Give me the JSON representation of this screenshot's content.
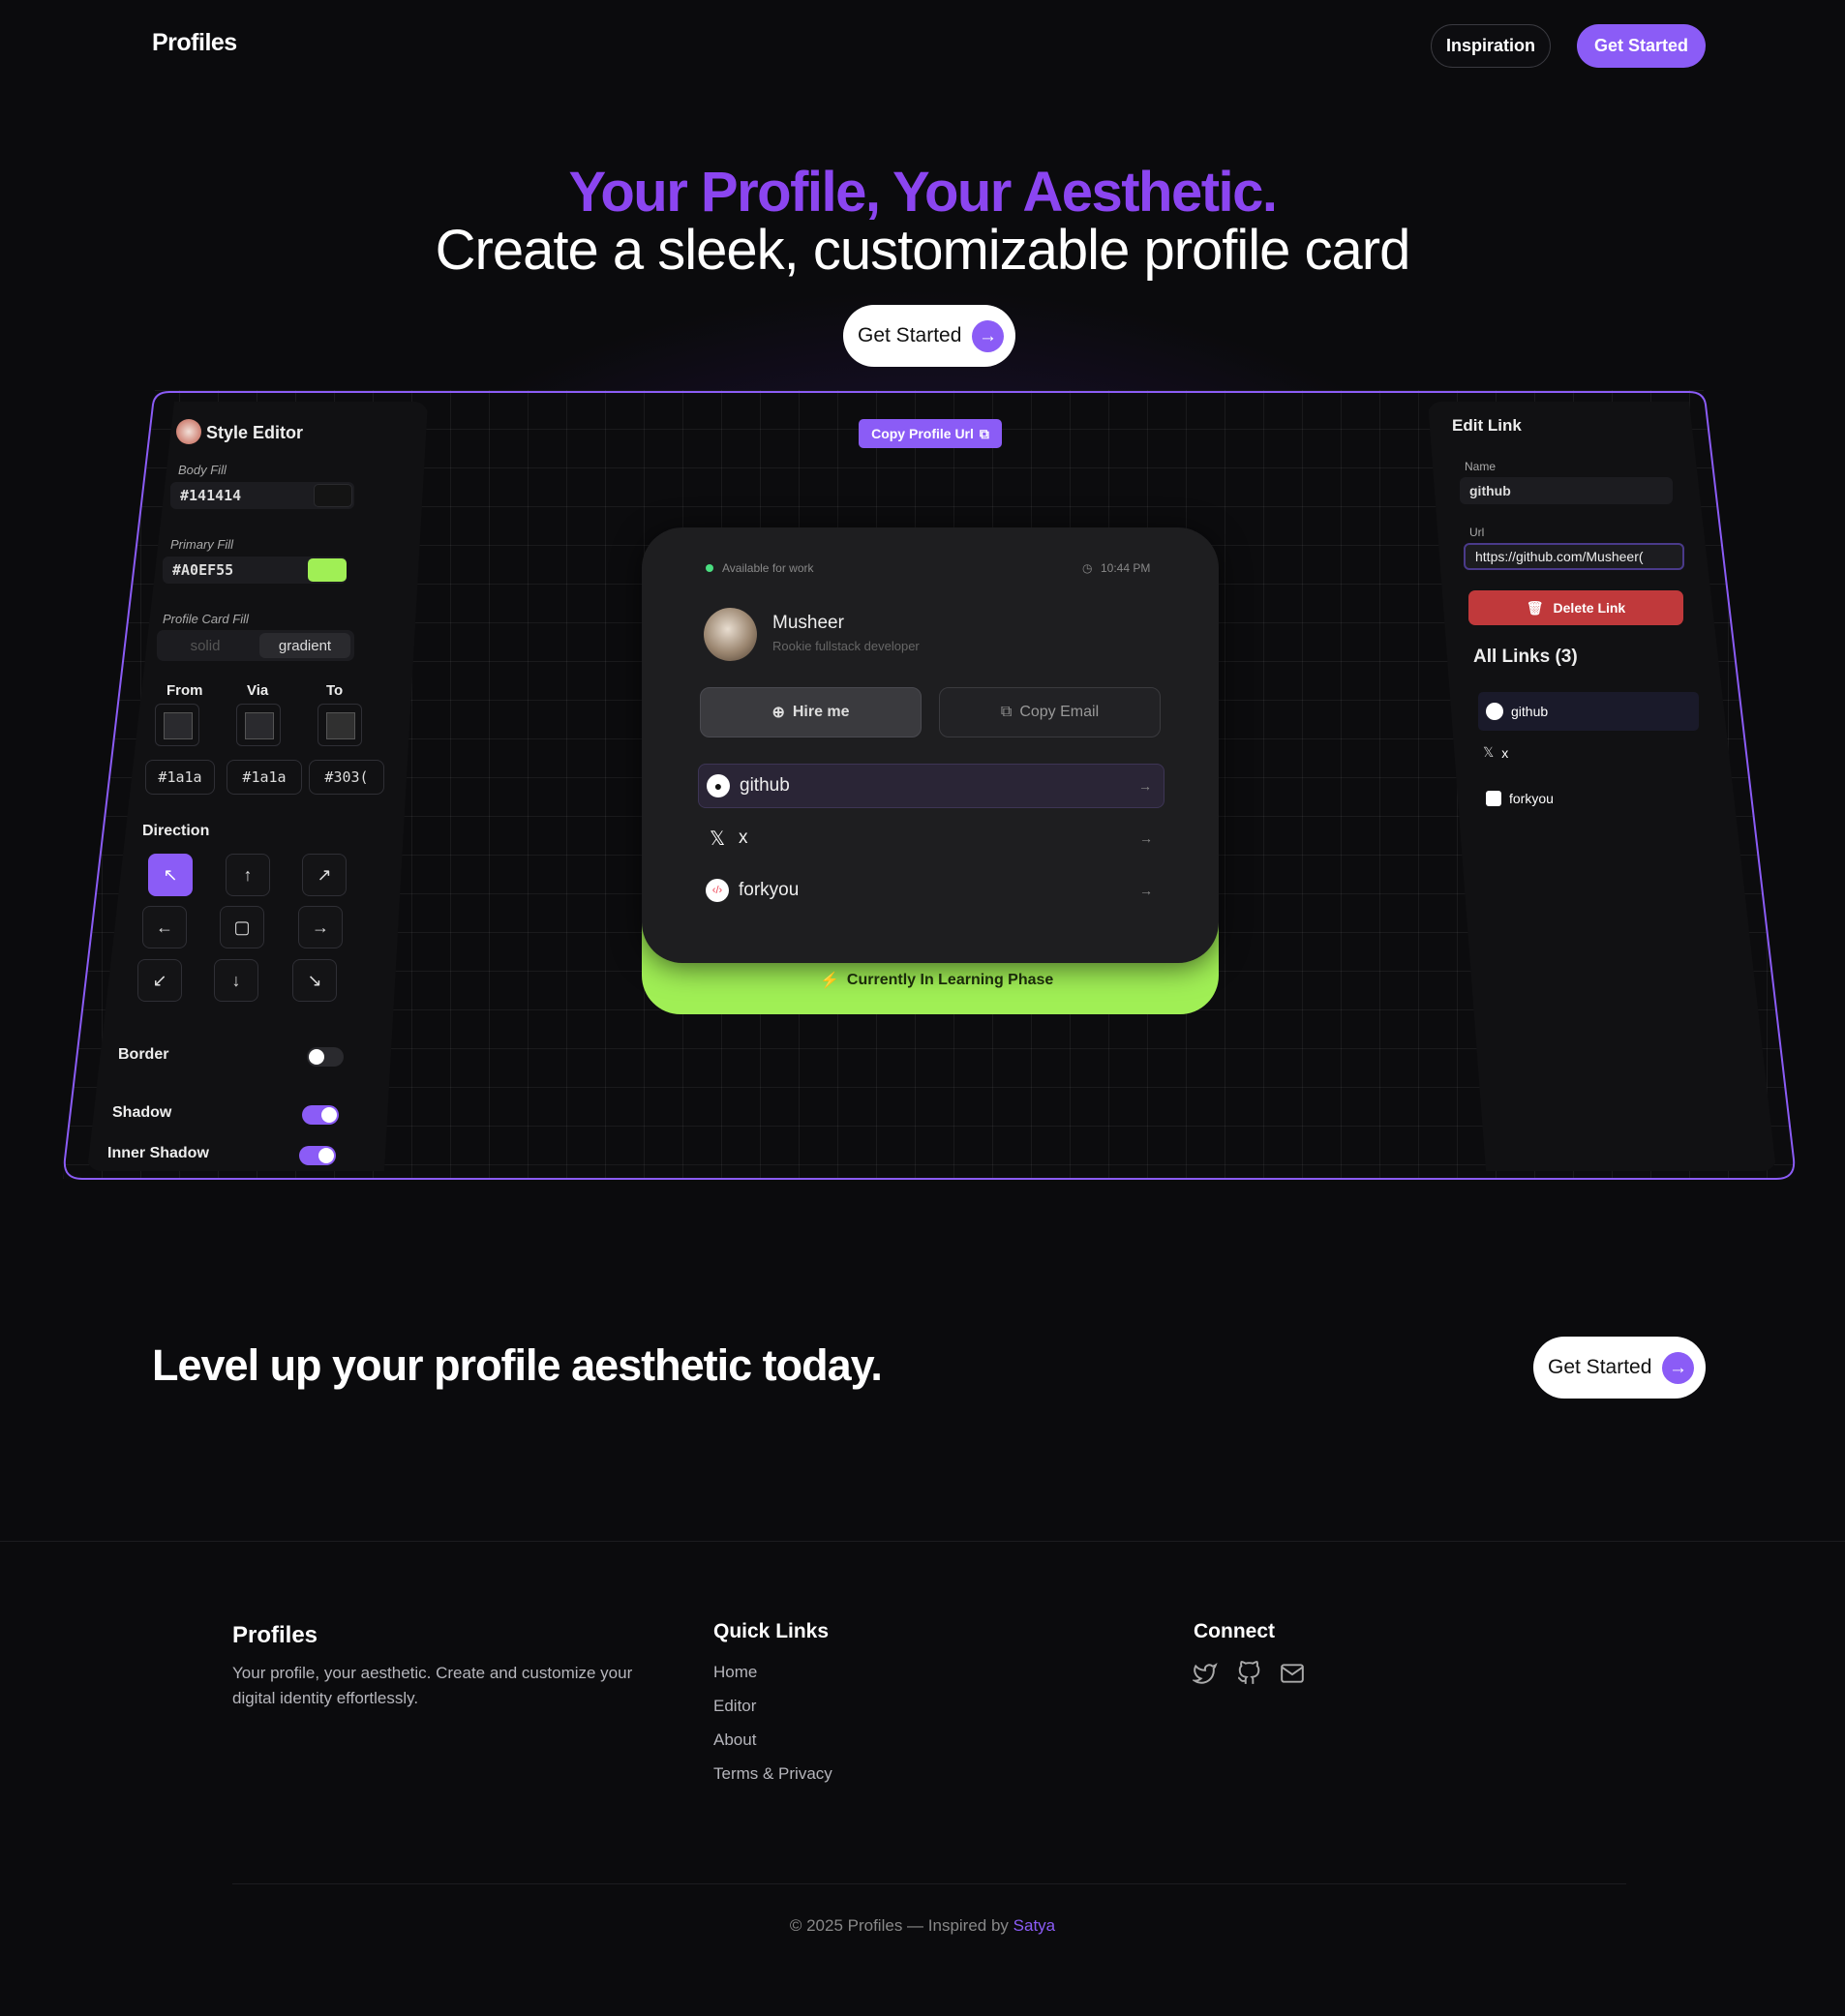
{
  "nav": {
    "brand": "Profiles",
    "inspiration": "Inspiration",
    "get_started": "Get Started"
  },
  "hero": {
    "line1": "Your Profile, Your Aesthetic.",
    "line2": "Create a sleek, customizable profile card",
    "cta": "Get Started"
  },
  "style_editor": {
    "title": "Style Editor",
    "body_fill_label": "Body Fill",
    "body_fill_value": "#141414",
    "primary_fill_label": "Primary Fill",
    "primary_fill_value": "#A0EF55",
    "card_fill_label": "Profile Card Fill",
    "solid": "solid",
    "gradient": "gradient",
    "from": "From",
    "via": "Via",
    "to": "To",
    "from_hex": "#1a1a",
    "via_hex": "#1a1a",
    "to_hex": "#303(",
    "direction_label": "Direction",
    "border_label": "Border",
    "shadow_label": "Shadow",
    "inner_shadow_label": "Inner Shadow",
    "border_on": false,
    "shadow_on": true,
    "inner_shadow_on": true
  },
  "copy_url": "Copy Profile Url",
  "card": {
    "status": "Available for work",
    "time": "10:44 PM",
    "name": "Musheer",
    "role": "Rookie fullstack developer",
    "hire": "Hire me",
    "copy_email": "Copy Email",
    "links": [
      {
        "label": "github",
        "icon": "github-icon"
      },
      {
        "label": "x",
        "icon": "x-icon"
      },
      {
        "label": "forkyou",
        "icon": "forkyou-icon"
      }
    ],
    "footer": "Currently In Learning Phase"
  },
  "edit_link": {
    "title": "Edit Link",
    "name_label": "Name",
    "name_value": "github",
    "url_label": "Url",
    "url_value": "https://github.com/Musheer(",
    "delete": "Delete Link",
    "all_links": "All Links (3)",
    "links": [
      "github",
      "x",
      "forkyou"
    ]
  },
  "promo": {
    "text": "Level up your profile aesthetic today.",
    "cta": "Get Started"
  },
  "footer": {
    "brand": "Profiles",
    "desc": "Your profile, your aesthetic. Create and customize your digital identity effortlessly.",
    "quick_links_title": "Quick Links",
    "quick_links": [
      "Home",
      "Editor",
      "About",
      "Terms & Privacy"
    ],
    "connect_title": "Connect",
    "copyright": "© 2025 Profiles — Inspired by ",
    "inspired_name": "Satya"
  },
  "colors": {
    "accent": "#8b5cf6",
    "primary": "#a0ef55",
    "danger": "#c0393b"
  }
}
